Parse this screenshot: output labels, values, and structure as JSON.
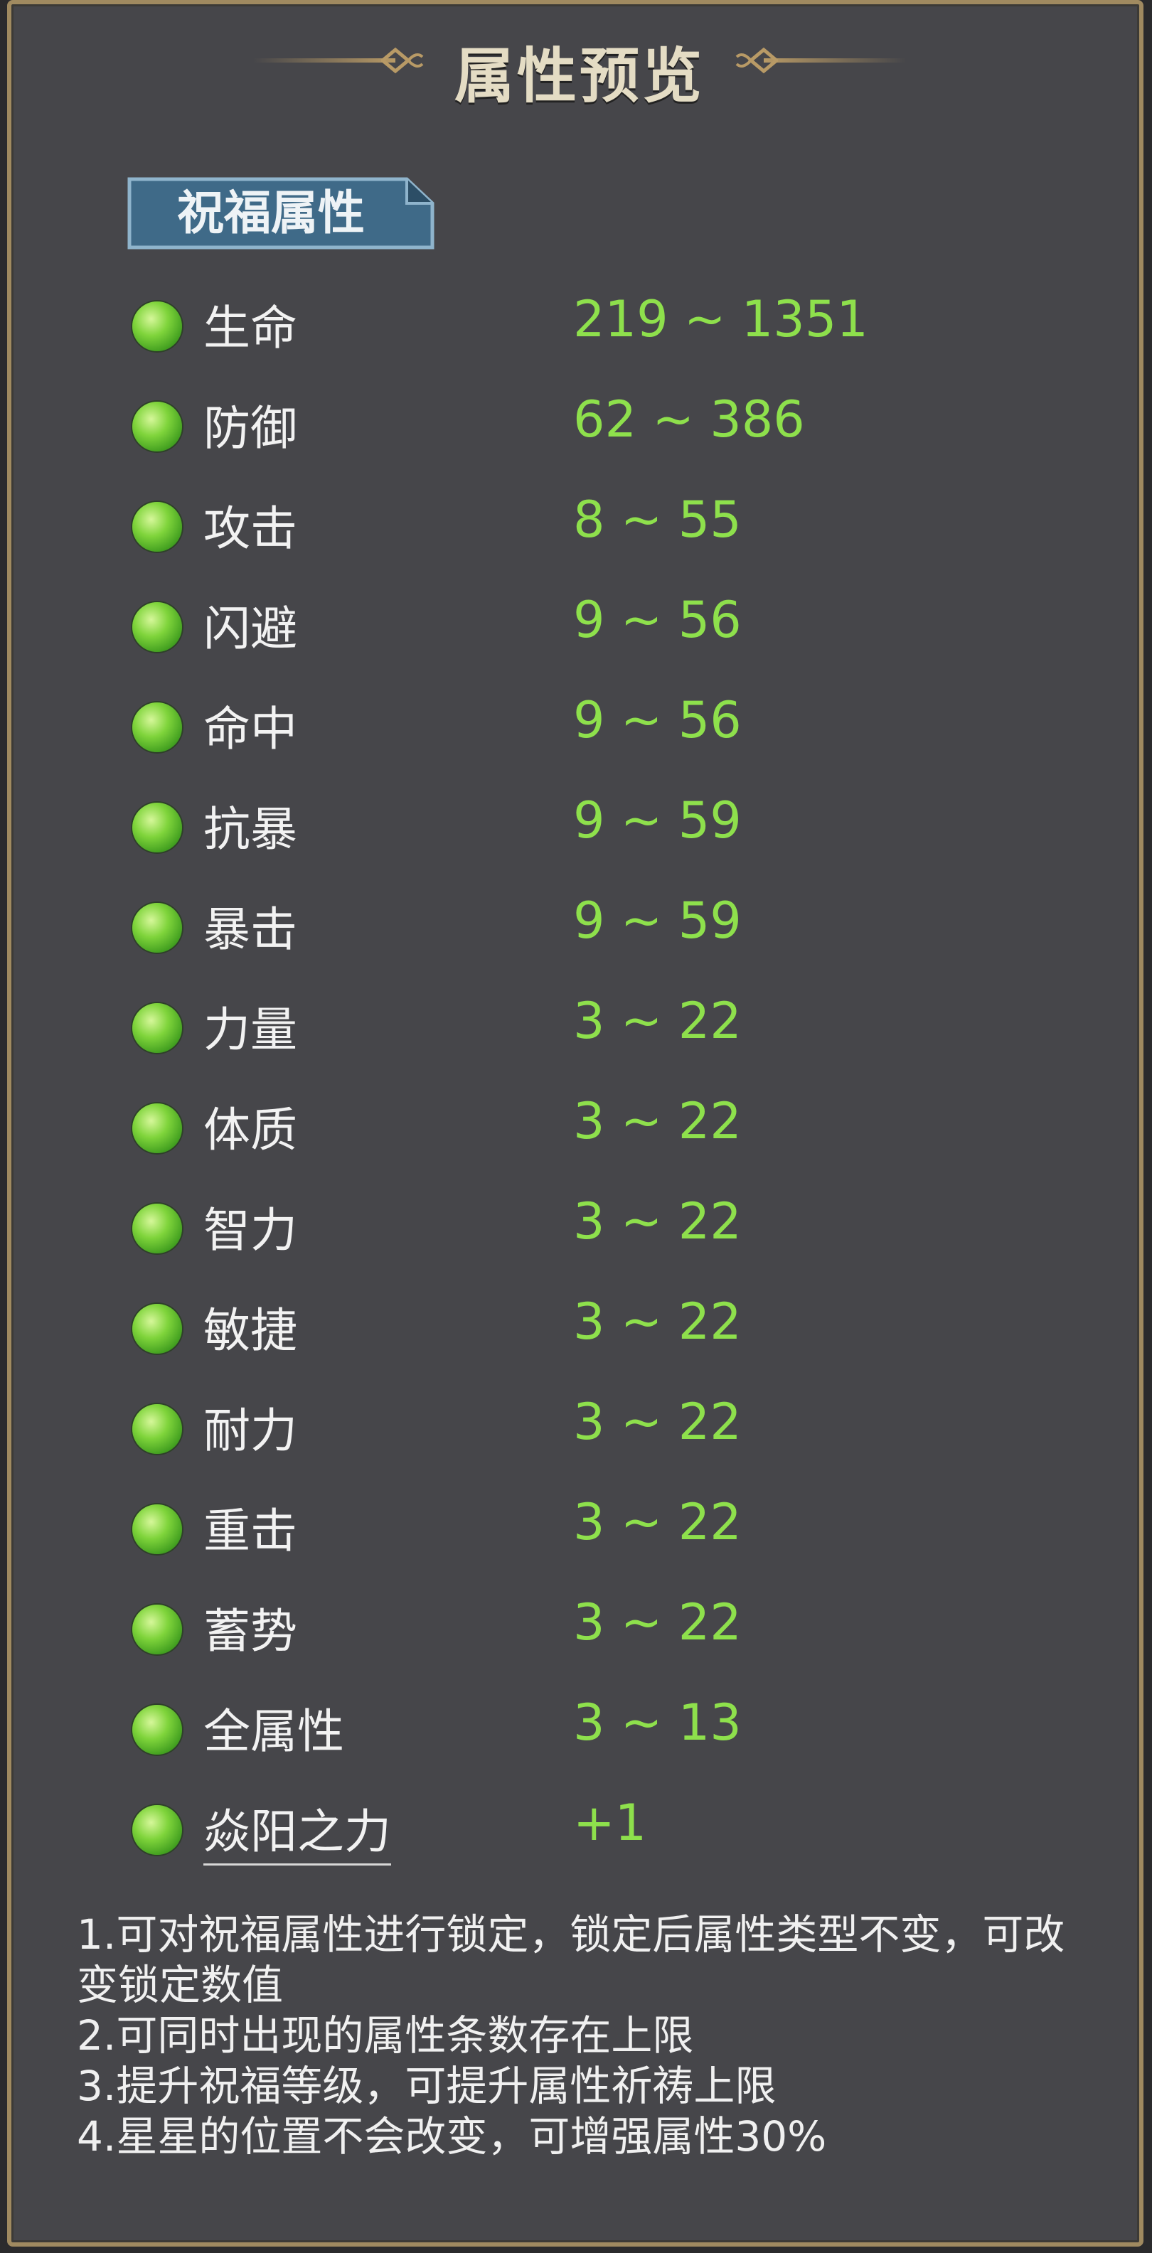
{
  "header": {
    "title": "属性预览"
  },
  "tag": {
    "label": "祝福属性"
  },
  "attributes": [
    {
      "name": "生命",
      "range": "219 ~ 1351"
    },
    {
      "name": "防御",
      "range": "62 ~ 386"
    },
    {
      "name": "攻击",
      "range": "8 ~ 55"
    },
    {
      "name": "闪避",
      "range": "9 ~ 56"
    },
    {
      "name": "命中",
      "range": "9 ~ 56"
    },
    {
      "name": "抗暴",
      "range": "9 ~ 59"
    },
    {
      "name": "暴击",
      "range": "9 ~ 59"
    },
    {
      "name": "力量",
      "range": "3 ~ 22"
    },
    {
      "name": "体质",
      "range": "3 ~ 22"
    },
    {
      "name": "智力",
      "range": "3 ~ 22"
    },
    {
      "name": "敏捷",
      "range": "3 ~ 22"
    },
    {
      "name": "耐力",
      "range": "3 ~ 22"
    },
    {
      "name": "重击",
      "range": "3 ~ 22"
    },
    {
      "name": "蓄势",
      "range": "3 ~ 22"
    },
    {
      "name": "全属性",
      "range": "3 ~ 13"
    },
    {
      "name": "焱阳之力",
      "range": "+1"
    }
  ],
  "notes": [
    "1.可对祝福属性进行锁定，锁定后属性类型不变，可改变锁定数值",
    "2.可同时出现的属性条数存在上限",
    "3.提升祝福等级，可提升属性祈祷上限",
    "4.星星的位置不会改变，可增强属性30%"
  ],
  "colors": {
    "value_green": "#8ee04c",
    "panel_border": "#a08a60",
    "tag_blue": "#3f6a88"
  },
  "icons": {
    "attribute_bullet": "green-orb-icon"
  }
}
